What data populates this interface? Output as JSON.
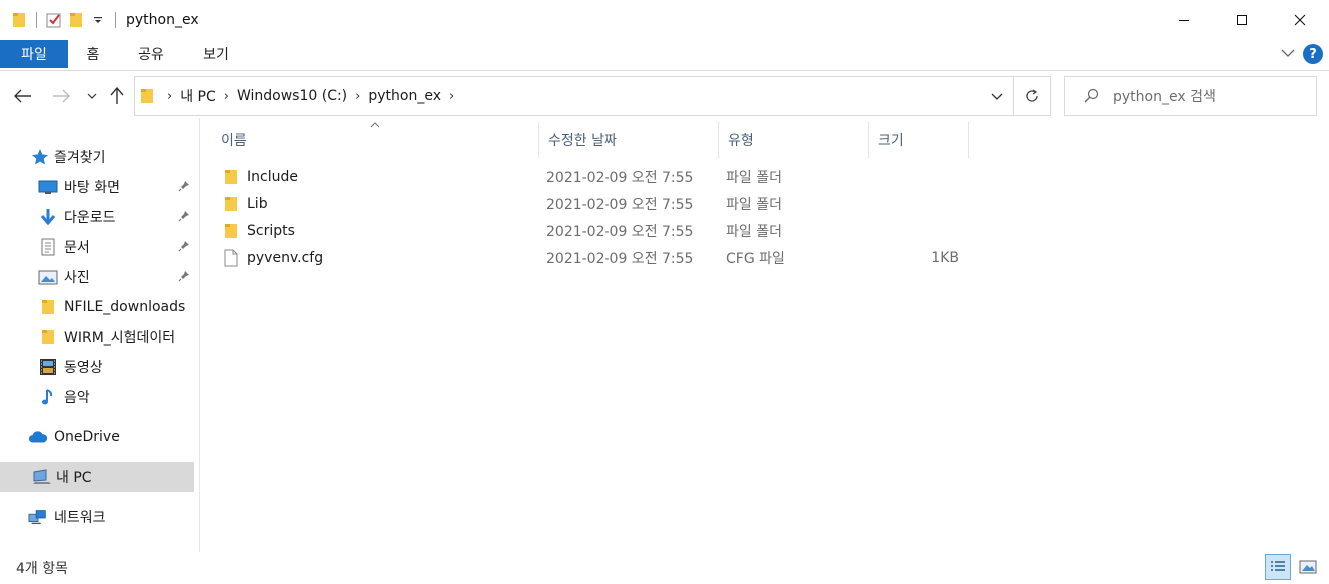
{
  "window": {
    "title": "python_ex"
  },
  "ribbon": {
    "tabs": [
      "파일",
      "홈",
      "공유",
      "보기"
    ],
    "help_label": "?"
  },
  "address": {
    "crumbs": [
      "내 PC",
      "Windows10 (C:)",
      "python_ex"
    ]
  },
  "search": {
    "placeholder": "python_ex 검색"
  },
  "nav": {
    "quick_access": "즐겨찾기",
    "items": [
      {
        "label": "바탕 화면",
        "icon": "desktop-icon",
        "pinned": true
      },
      {
        "label": "다운로드",
        "icon": "download-icon",
        "pinned": true
      },
      {
        "label": "문서",
        "icon": "document-icon",
        "pinned": true
      },
      {
        "label": "사진",
        "icon": "pictures-icon",
        "pinned": true
      },
      {
        "label": "NFILE_downloads",
        "icon": "folder-icon",
        "pinned": false
      },
      {
        "label": "WIRM_시험데이터",
        "icon": "folder-icon",
        "pinned": false
      },
      {
        "label": "동영상",
        "icon": "video-icon",
        "pinned": false
      },
      {
        "label": "음악",
        "icon": "music-icon",
        "pinned": false
      }
    ],
    "onedrive": "OneDrive",
    "this_pc": "내 PC",
    "network": "네트워크"
  },
  "columns": {
    "name": "이름",
    "modified": "수정한 날짜",
    "type": "유형",
    "size": "크기"
  },
  "files": [
    {
      "name": "Include",
      "modified": "2021-02-09 오전 7:55",
      "type": "파일 폴더",
      "size": "",
      "icon": "folder-icon"
    },
    {
      "name": "Lib",
      "modified": "2021-02-09 오전 7:55",
      "type": "파일 폴더",
      "size": "",
      "icon": "folder-icon"
    },
    {
      "name": "Scripts",
      "modified": "2021-02-09 오전 7:55",
      "type": "파일 폴더",
      "size": "",
      "icon": "folder-icon"
    },
    {
      "name": "pyvenv.cfg",
      "modified": "2021-02-09 오전 7:55",
      "type": "CFG 파일",
      "size": "1KB",
      "icon": "file-icon"
    }
  ],
  "status": {
    "item_count": "4개 항목"
  },
  "colors": {
    "accent": "#1a6fc4",
    "folder": "#f7c948",
    "selected_nav": "#d9d9d9"
  }
}
